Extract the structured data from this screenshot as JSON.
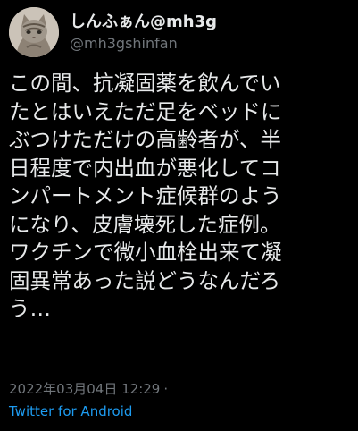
{
  "tweet": {
    "author": {
      "display_name": "しんふぁん@mh3g",
      "handle": "@mh3gshinfan"
    },
    "text_lines": [
      "この間、抗凝固薬を飲んでい",
      "たとはいえただ足をベッドに",
      "ぶつけただけの高齢者が、半",
      "日程度で内出血が悪化してコ",
      "ンパートメント症候群のよう",
      "になり、皮膚壊死した症例。",
      "ワクチンで微小血栓出来て凝",
      "固異常あった説どうなんだろ",
      "う…"
    ],
    "timestamp": "2022年03月04日 12:29",
    "separator": "·",
    "source": "Twitter for Android"
  },
  "colors": {
    "background": "#000000",
    "primary_text": "#e7e9ea",
    "secondary_text": "#71767b",
    "link": "#1d9bf0"
  },
  "icons": {
    "avatar": "cat-avatar-icon"
  }
}
